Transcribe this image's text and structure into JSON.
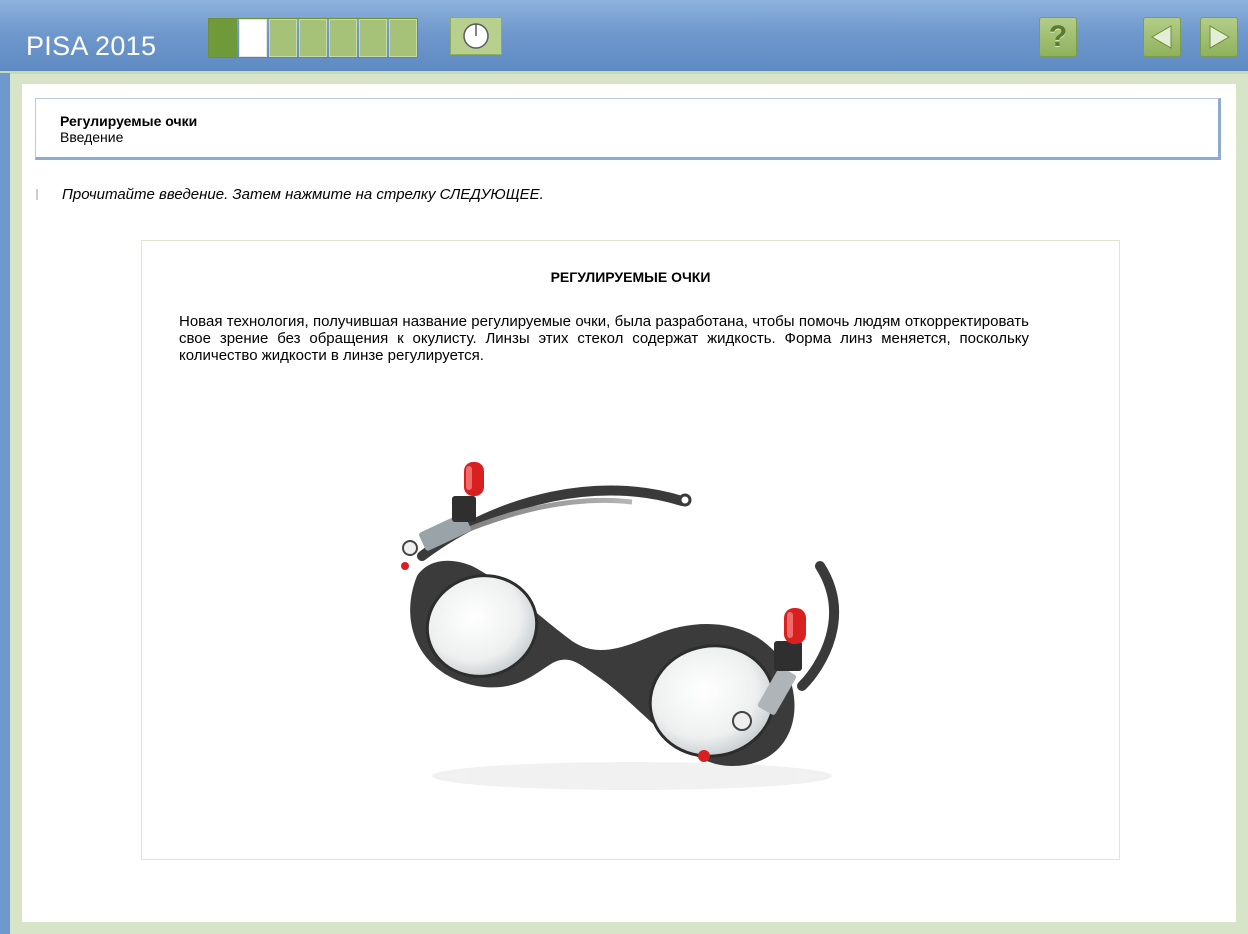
{
  "header": {
    "app_title": "PISA 2015",
    "progress": {
      "total": 7,
      "completed": 1,
      "current": 2
    },
    "icons": {
      "timer": "timer-clock-icon",
      "help": "question-mark-icon",
      "back": "arrow-left-icon",
      "next": "arrow-right-icon"
    },
    "help_label": "?"
  },
  "unit": {
    "title": "Регулируемые очки",
    "subtitle": "Введение"
  },
  "instruction": "Прочитайте введение. Затем нажмите на стрелку СЛЕДУЮЩЕЕ.",
  "stimulus": {
    "heading": "РЕГУЛИРУЕМЫЕ ОЧКИ",
    "paragraph": "Новая технология, получившая название регулируемые очки, была разработана, чтобы помочь людям откорректировать свое зрение без обращения к окулисту. Линзы этих стекол содержат жидкость. Форма линз меняется, поскольку количество жидкости в линзе регулируется.",
    "image": "adjustable-glasses-photo"
  },
  "colors": {
    "header_blue": "#6f98cc",
    "frame_green": "#d8e4c8",
    "progress_done": "#6e9a3a",
    "progress_todo": "#a6c278",
    "button_green": "#9bbc6a",
    "accent_red": "#e02020"
  }
}
